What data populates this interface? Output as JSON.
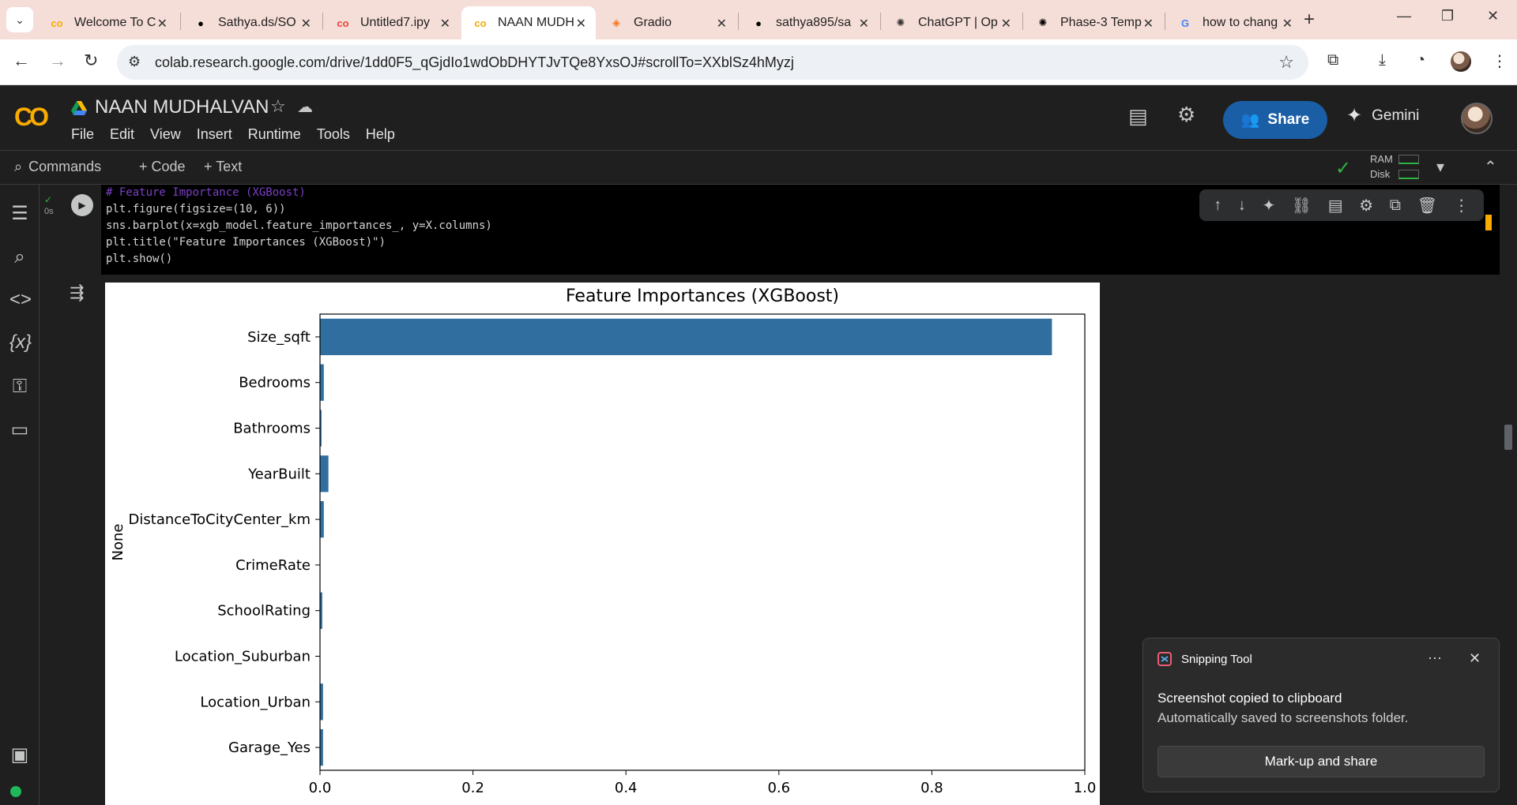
{
  "browser": {
    "tabs": [
      {
        "label": "Welcome To C",
        "icon": "colab-icon",
        "active": false
      },
      {
        "label": "Sathya.ds/SO",
        "icon": "github-icon",
        "active": false
      },
      {
        "label": "Untitled7.ipy",
        "icon": "colab-icon",
        "active": false
      },
      {
        "label": "NAAN MUDH",
        "icon": "colab-icon",
        "active": true
      },
      {
        "label": "Gradio",
        "icon": "gradio-icon",
        "active": false
      },
      {
        "label": "sathya895/sa",
        "icon": "github-icon",
        "active": false
      },
      {
        "label": "ChatGPT | Op",
        "icon": "openai-icon",
        "active": false
      },
      {
        "label": "Phase-3 Temp",
        "icon": "openai-icon",
        "active": false
      },
      {
        "label": "how to chang",
        "icon": "google-icon",
        "active": false
      }
    ],
    "url": "colab.research.google.com/drive/1dd0F5_qGjdIo1wdObDHYTJvTQe8YxsOJ#scrollTo=XXblSz4hMyzj"
  },
  "colab": {
    "title": "NAAN MUDHALVAN",
    "menu": [
      "File",
      "Edit",
      "View",
      "Insert",
      "Runtime",
      "Tools",
      "Help"
    ],
    "share_label": "Share",
    "gemini_label": "Gemini",
    "commands_label": "Commands",
    "add_code_label": "+ Code",
    "add_text_label": "+ Text",
    "ram_label": "RAM",
    "disk_label": "Disk"
  },
  "cell": {
    "exec_time": "0s",
    "code_lines": [
      "# Feature Importance (XGBoost)",
      "plt.figure(figsize=(10, 6))",
      "sns.barplot(x=xgb_model.feature_importances_, y=X.columns)",
      "plt.title(\"Feature Importances (XGBoost)\")",
      "plt.show()"
    ]
  },
  "chart_data": {
    "type": "bar",
    "orientation": "horizontal",
    "title": "Feature Importances (XGBoost)",
    "xlabel": "",
    "ylabel": "None",
    "categories": [
      "Size_sqft",
      "Bedrooms",
      "Bathrooms",
      "YearBuilt",
      "DistanceToCityCenter_km",
      "CrimeRate",
      "SchoolRating",
      "Location_Suburban",
      "Location_Urban",
      "Garage_Yes"
    ],
    "values": [
      0.957,
      0.005,
      0.002,
      0.011,
      0.005,
      0.0,
      0.003,
      0.0,
      0.004,
      0.004
    ],
    "xlim": [
      0.0,
      1.0
    ],
    "xticks": [
      "0.0",
      "0.2",
      "0.4",
      "0.6",
      "0.8",
      "1.0"
    ],
    "bar_color": "#2f6e9f",
    "grid": false
  },
  "toast": {
    "app": "Snipping Tool",
    "more": "···",
    "title": "Screenshot copied to clipboard",
    "subtitle": "Automatically saved to screenshots folder.",
    "button": "Mark-up and share"
  }
}
